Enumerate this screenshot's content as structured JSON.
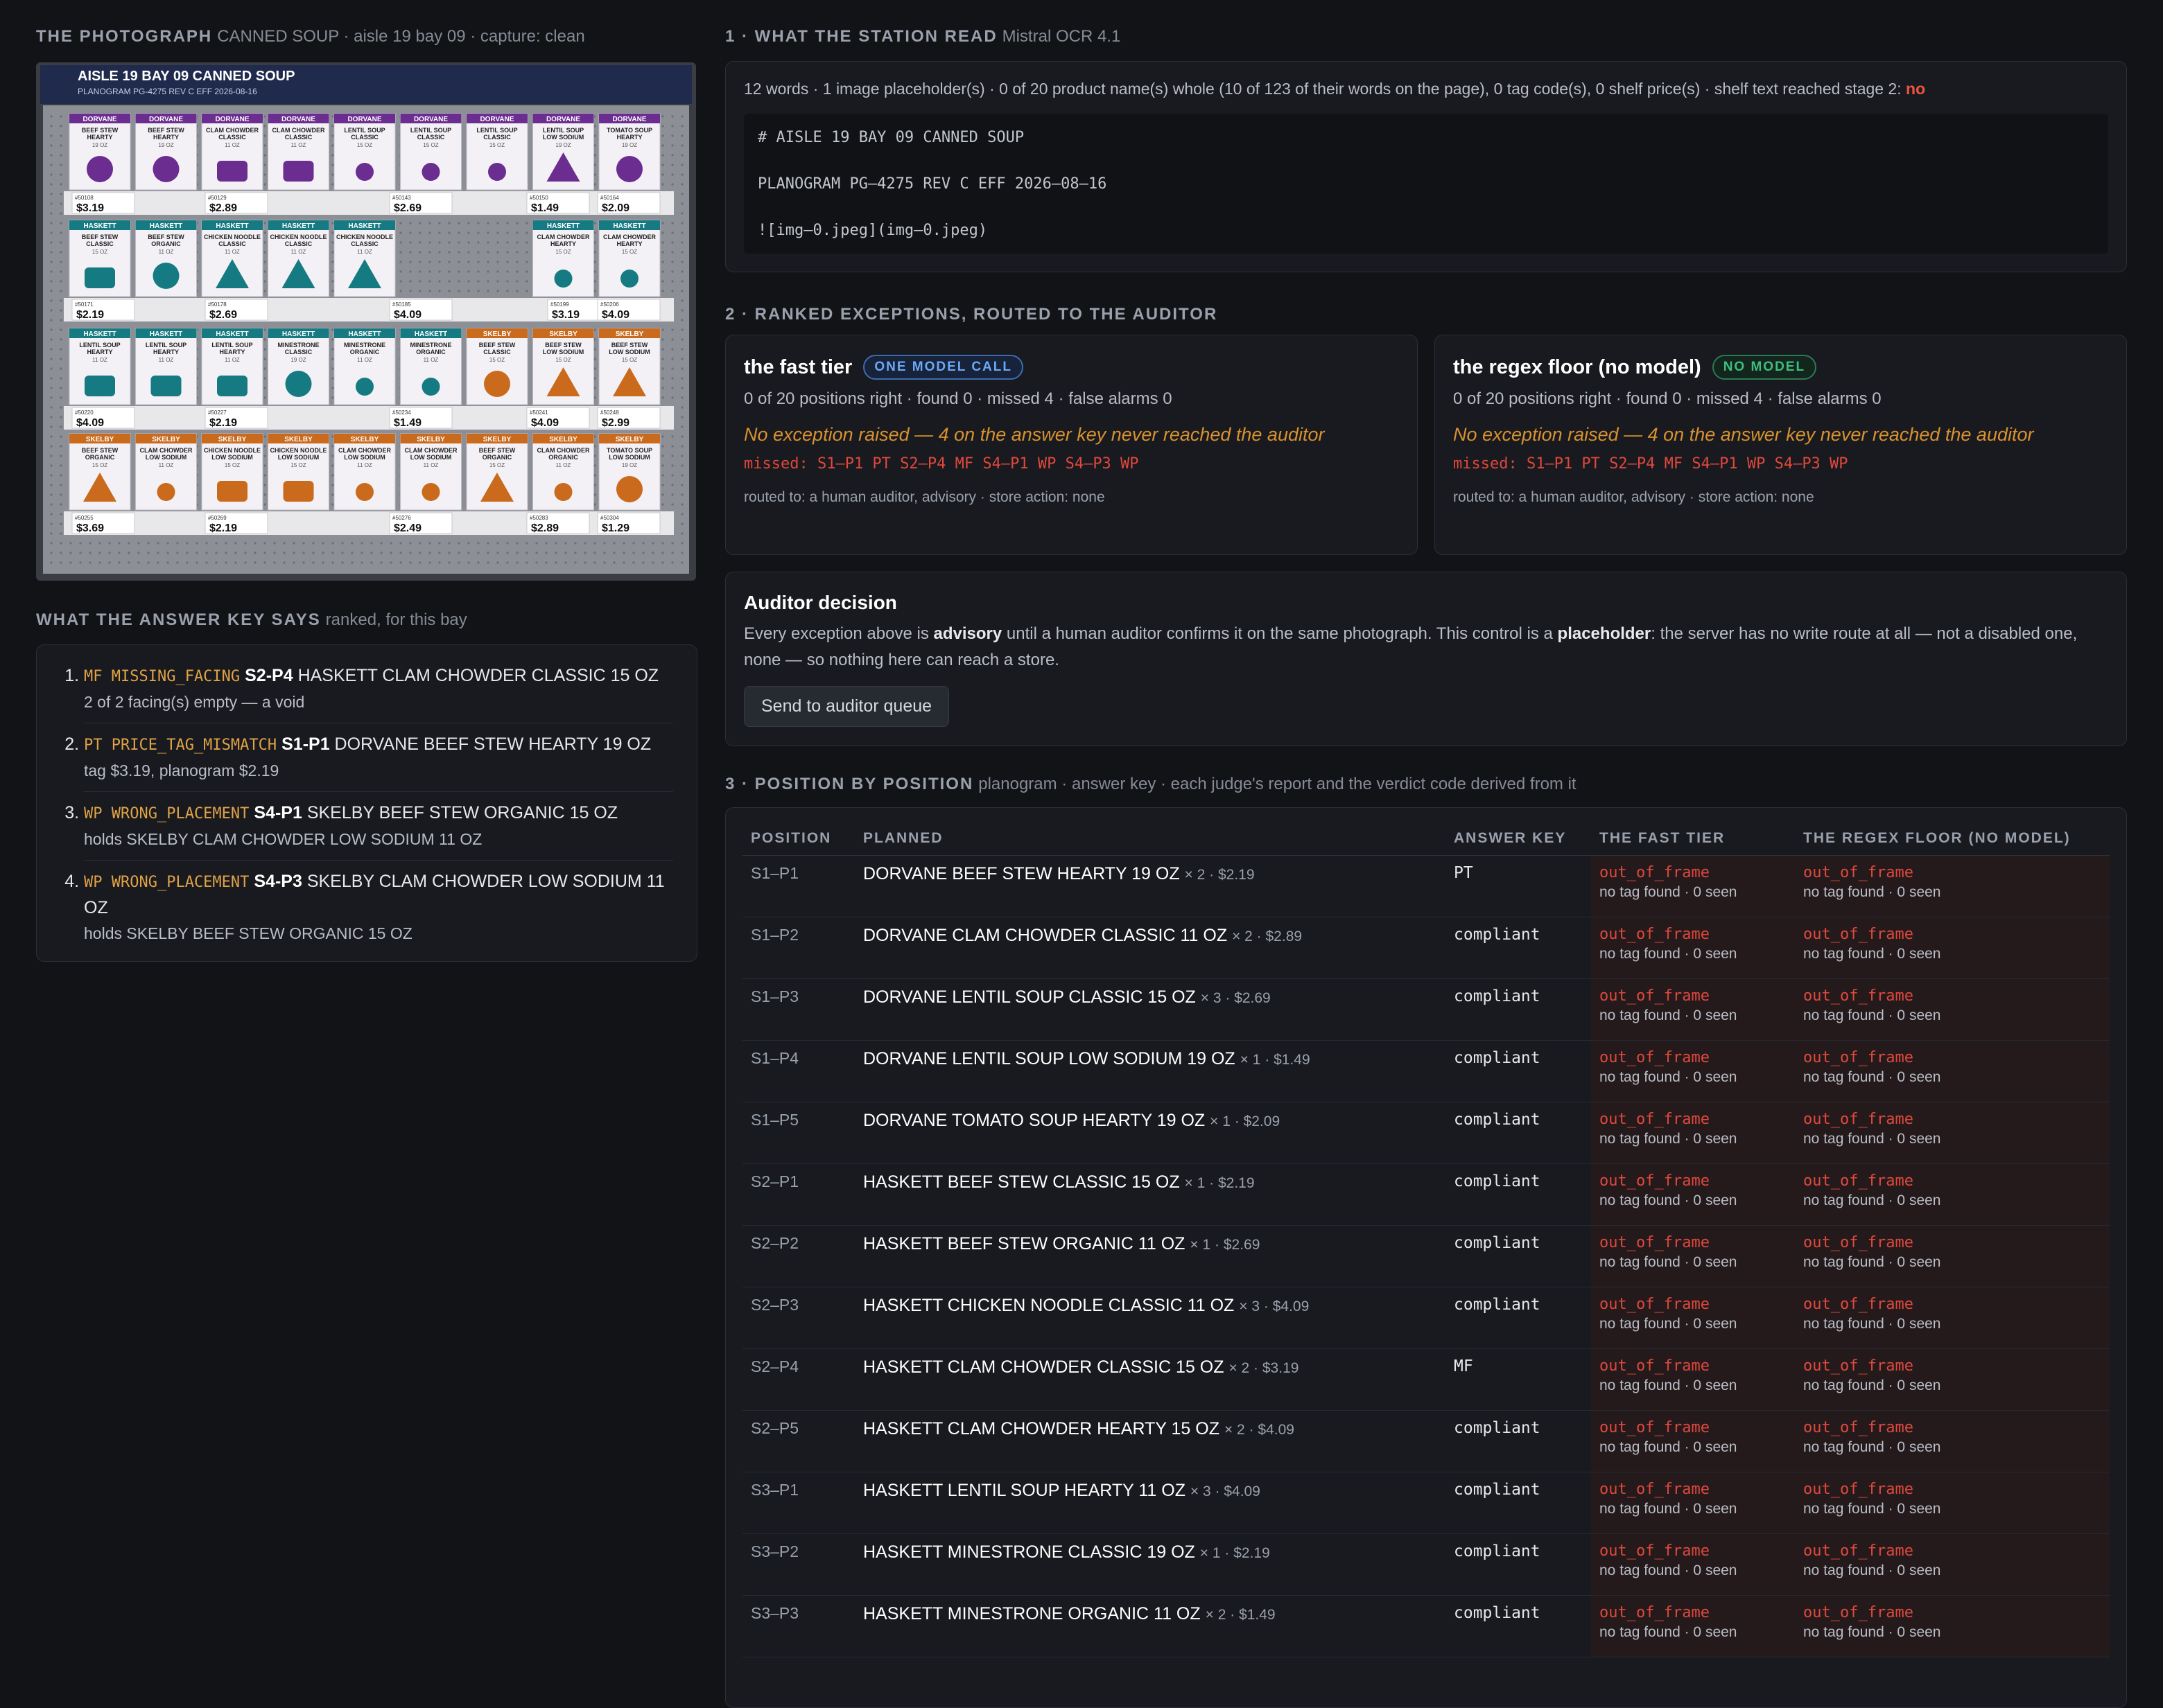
{
  "photo_section": {
    "title": "THE PHOTOGRAPH",
    "subtitle": "CANNED SOUP · aisle 19 bay 09 · capture: clean",
    "header_line": "AISLE 19    BAY 09    CANNED SOUP",
    "header_sub": "PLANOGRAM PG-4275   REV C   EFF 2026-08-16",
    "shelves": [
      [
        {
          "brand": "DORVANE",
          "name": "BEEF STEW HEARTY",
          "size": "19 OZ",
          "shape": "circle"
        },
        {
          "brand": "DORVANE",
          "name": "BEEF STEW HEARTY",
          "size": "19 OZ",
          "shape": "circle"
        },
        {
          "brand": "DORVANE",
          "name": "CLAM CHOWDER CLASSIC",
          "size": "11 OZ",
          "shape": "rect"
        },
        {
          "brand": "DORVANE",
          "name": "CLAM CHOWDER CLASSIC",
          "size": "11 OZ",
          "shape": "rect"
        },
        {
          "brand": "DORVANE",
          "name": "LENTIL SOUP CLASSIC",
          "size": "15 OZ",
          "shape": "small"
        },
        {
          "brand": "DORVANE",
          "name": "LENTIL SOUP CLASSIC",
          "size": "15 OZ",
          "shape": "small"
        },
        {
          "brand": "DORVANE",
          "name": "LENTIL SOUP CLASSIC",
          "size": "15 OZ",
          "shape": "small"
        },
        {
          "brand": "DORVANE",
          "name": "LENTIL SOUP LOW SODIUM",
          "size": "19 OZ",
          "shape": "tri"
        },
        {
          "brand": "DORVANE",
          "name": "TOMATO SOUP HEARTY",
          "size": "19 OZ",
          "shape": "circle"
        }
      ],
      [
        {
          "brand": "HASKETT",
          "name": "BEEF STEW CLASSIC",
          "size": "15 OZ",
          "shape": "rect"
        },
        {
          "brand": "HASKETT",
          "name": "BEEF STEW ORGANIC",
          "size": "11 OZ",
          "shape": "circle"
        },
        {
          "brand": "HASKETT",
          "name": "CHICKEN NOODLE CLASSIC",
          "size": "11 OZ",
          "shape": "tri"
        },
        {
          "brand": "HASKETT",
          "name": "CHICKEN NOODLE CLASSIC",
          "size": "11 OZ",
          "shape": "tri"
        },
        {
          "brand": "HASKETT",
          "name": "CHICKEN NOODLE CLASSIC",
          "size": "11 OZ",
          "shape": "tri"
        },
        null,
        null,
        {
          "brand": "HASKETT",
          "name": "CLAM CHOWDER HEARTY",
          "size": "15 OZ",
          "shape": "small"
        },
        {
          "brand": "HASKETT",
          "name": "CLAM CHOWDER HEARTY",
          "size": "15 OZ",
          "shape": "small"
        }
      ],
      [
        {
          "brand": "HASKETT",
          "name": "LENTIL SOUP HEARTY",
          "size": "11 OZ",
          "shape": "rect"
        },
        {
          "brand": "HASKETT",
          "name": "LENTIL SOUP HEARTY",
          "size": "11 OZ",
          "shape": "rect"
        },
        {
          "brand": "HASKETT",
          "name": "LENTIL SOUP HEARTY",
          "size": "11 OZ",
          "shape": "rect"
        },
        {
          "brand": "HASKETT",
          "name": "MINESTRONE CLASSIC",
          "size": "19 OZ",
          "shape": "circle"
        },
        {
          "brand": "HASKETT",
          "name": "MINESTRONE ORGANIC",
          "size": "11 OZ",
          "shape": "small"
        },
        {
          "brand": "HASKETT",
          "name": "MINESTRONE ORGANIC",
          "size": "11 OZ",
          "shape": "small"
        },
        {
          "brand": "SKELBY",
          "name": "BEEF STEW CLASSIC",
          "size": "15 OZ",
          "shape": "circle"
        },
        {
          "brand": "SKELBY",
          "name": "BEEF STEW LOW SODIUM",
          "size": "15 OZ",
          "shape": "tri"
        },
        {
          "brand": "SKELBY",
          "name": "BEEF STEW LOW SODIUM",
          "size": "15 OZ",
          "shape": "tri"
        }
      ],
      [
        {
          "brand": "SKELBY",
          "name": "BEEF STEW ORGANIC",
          "size": "15 OZ",
          "shape": "tri"
        },
        {
          "brand": "SKELBY",
          "name": "CLAM CHOWDER LOW SODIUM",
          "size": "11 OZ",
          "shape": "small"
        },
        {
          "brand": "SKELBY",
          "name": "CHICKEN NOODLE LOW SODIUM",
          "size": "15 OZ",
          "shape": "rect"
        },
        {
          "brand": "SKELBY",
          "name": "CHICKEN NOODLE LOW SODIUM",
          "size": "15 OZ",
          "shape": "rect"
        },
        {
          "brand": "SKELBY",
          "name": "CLAM CHOWDER LOW SODIUM",
          "size": "11 OZ",
          "shape": "small"
        },
        {
          "brand": "SKELBY",
          "name": "CLAM CHOWDER LOW SODIUM",
          "size": "11 OZ",
          "shape": "small"
        },
        {
          "brand": "SKELBY",
          "name": "BEEF STEW ORGANIC",
          "size": "15 OZ",
          "shape": "tri"
        },
        {
          "brand": "SKELBY",
          "name": "CLAM CHOWDER ORGANIC",
          "size": "11 OZ",
          "shape": "small"
        },
        {
          "brand": "SKELBY",
          "name": "TOMATO SOUP LOW SODIUM",
          "size": "19 OZ",
          "shape": "circle"
        }
      ]
    ],
    "tags": [
      [
        {
          "code": "#50108",
          "price": "$3.19"
        },
        {
          "code": "#50129",
          "price": "$2.89"
        },
        {
          "code": "#50143",
          "price": "$2.69"
        },
        {
          "code": "#50150",
          "price": "$1.49"
        },
        {
          "code": "#50164",
          "price": "$2.09"
        }
      ],
      [
        {
          "code": "#50171",
          "price": "$2.19"
        },
        {
          "code": "#50178",
          "price": "$2.69"
        },
        {
          "code": "#50185",
          "price": "$4.09"
        },
        {
          "code": "#50199",
          "price": "$3.19"
        },
        {
          "code": "#50206",
          "price": "$4.09"
        }
      ],
      [
        {
          "code": "#50220",
          "price": "$4.09"
        },
        {
          "code": "#50227",
          "price": "$2.19"
        },
        {
          "code": "#50234",
          "price": "$1.49"
        },
        {
          "code": "#50241",
          "price": "$4.09"
        },
        {
          "code": "#50248",
          "price": "$2.99"
        }
      ],
      [
        {
          "code": "#50255",
          "price": "$3.69"
        },
        {
          "code": "#50269",
          "price": "$2.19"
        },
        {
          "code": "#50276",
          "price": "$2.49"
        },
        {
          "code": "#50283",
          "price": "$2.89"
        },
        {
          "code": "#50304",
          "price": "$1.29"
        }
      ]
    ],
    "brand_colors": {
      "DORVANE": "#6b2d8f",
      "HASKETT": "#157a82",
      "SKELBY": "#c96a1c"
    }
  },
  "answer_key": {
    "title": "WHAT THE ANSWER KEY SAYS",
    "subtitle": "ranked, for this bay",
    "items": [
      {
        "code": "MF MISSING_FACING",
        "pos": "S2-P4",
        "product": "HASKETT CLAM CHOWDER CLASSIC 15 OZ",
        "detail": "2 of 2 facing(s) empty — a void"
      },
      {
        "code": "PT PRICE_TAG_MISMATCH",
        "pos": "S1-P1",
        "product": "DORVANE BEEF STEW HEARTY 19 OZ",
        "detail": "tag $3.19, planogram $2.19"
      },
      {
        "code": "WP WRONG_PLACEMENT",
        "pos": "S4-P1",
        "product": "SKELBY BEEF STEW ORGANIC 15 OZ",
        "detail": "holds SKELBY CLAM CHOWDER LOW SODIUM 11 OZ"
      },
      {
        "code": "WP WRONG_PLACEMENT",
        "pos": "S4-P3",
        "product": "SKELBY CLAM CHOWDER LOW SODIUM 11 OZ",
        "detail": "holds SKELBY BEEF STEW ORGANIC 15 OZ"
      }
    ]
  },
  "station": {
    "title": "1 · WHAT THE STATION READ",
    "subtitle": "Mistral OCR 4.1",
    "summary": "12 words · 1 image placeholder(s) · 0 of 20 product name(s) whole (10 of 123 of their words on the page), 0 tag code(s), 0 shelf price(s) · shelf text reached stage 2:",
    "summary_flag": "no",
    "ocr_lines": [
      "# AISLE 19 BAY 09 CANNED SOUP",
      "PLANOGRAM PG–4275 REV C EFF 2026–08–16",
      "![img–0.jpeg](img–0.jpeg)"
    ]
  },
  "exceptions": {
    "title": "2 · RANKED EXCEPTIONS, ROUTED TO THE AUDITOR",
    "tiers": [
      {
        "name": "the fast tier",
        "badge": "ONE MODEL CALL",
        "stats": "0 of 20 positions right · found 0 · missed 4 · false alarms 0",
        "warning": "No exception raised — 4 on the answer key never reached the auditor",
        "missed": "missed: S1–P1 PT S2–P4 MF S4–P1 WP S4–P3 WP",
        "route": "routed to: a human auditor, advisory · store action: none"
      },
      {
        "name": "the regex floor (no model)",
        "badge": "NO MODEL",
        "stats": "0 of 20 positions right · found 0 · missed 4 · false alarms 0",
        "warning": "No exception raised — 4 on the answer key never reached the auditor",
        "missed": "missed: S1–P1 PT S2–P4 MF S4–P1 WP S4–P3 WP",
        "route": "routed to: a human auditor, advisory · store action: none"
      }
    ]
  },
  "auditor": {
    "title": "Auditor decision",
    "t1": "Every exception above is ",
    "b1": "advisory",
    "t2": " until a human auditor confirms it on the same photograph. This control is a ",
    "b2": "placeholder",
    "t3": ": the server has no write route at all — not a disabled one, none — so nothing here can reach a store.",
    "button": "Send to auditor queue"
  },
  "positions": {
    "title": "3 · POSITION BY POSITION",
    "subtitle": "planogram · answer key · each judge's report and the verdict code derived from it",
    "headers": [
      "POSITION",
      "PLANNED",
      "ANSWER KEY",
      "THE FAST TIER",
      "THE REGEX FLOOR (NO MODEL)"
    ],
    "verdict": "out_of_frame",
    "note": "no tag found · 0 seen",
    "rows": [
      {
        "pos": "S1–P1",
        "name": "DORVANE BEEF STEW HEARTY 19 OZ",
        "meta": "× 2 · $2.19",
        "key": "PT"
      },
      {
        "pos": "S1–P2",
        "name": "DORVANE CLAM CHOWDER CLASSIC 11 OZ",
        "meta": "× 2 · $2.89",
        "key": "compliant"
      },
      {
        "pos": "S1–P3",
        "name": "DORVANE LENTIL SOUP CLASSIC 15 OZ",
        "meta": "× 3 · $2.69",
        "key": "compliant"
      },
      {
        "pos": "S1–P4",
        "name": "DORVANE LENTIL SOUP LOW SODIUM 19 OZ",
        "meta": "× 1 · $1.49",
        "key": "compliant"
      },
      {
        "pos": "S1–P5",
        "name": "DORVANE TOMATO SOUP HEARTY 19 OZ",
        "meta": "× 1 · $2.09",
        "key": "compliant"
      },
      {
        "pos": "S2–P1",
        "name": "HASKETT BEEF STEW CLASSIC 15 OZ",
        "meta": "× 1 · $2.19",
        "key": "compliant"
      },
      {
        "pos": "S2–P2",
        "name": "HASKETT BEEF STEW ORGANIC 11 OZ",
        "meta": "× 1 · $2.69",
        "key": "compliant"
      },
      {
        "pos": "S2–P3",
        "name": "HASKETT CHICKEN NOODLE CLASSIC 11 OZ",
        "meta": "× 3 · $4.09",
        "key": "compliant"
      },
      {
        "pos": "S2–P4",
        "name": "HASKETT CLAM CHOWDER CLASSIC 15 OZ",
        "meta": "× 2 · $3.19",
        "key": "MF"
      },
      {
        "pos": "S2–P5",
        "name": "HASKETT CLAM CHOWDER HEARTY 15 OZ",
        "meta": "× 2 · $4.09",
        "key": "compliant"
      },
      {
        "pos": "S3–P1",
        "name": "HASKETT LENTIL SOUP HEARTY 11 OZ",
        "meta": "× 3 · $4.09",
        "key": "compliant"
      },
      {
        "pos": "S3–P2",
        "name": "HASKETT MINESTRONE CLASSIC 19 OZ",
        "meta": "× 1 · $2.19",
        "key": "compliant"
      },
      {
        "pos": "S3–P3",
        "name": "HASKETT MINESTRONE ORGANIC 11 OZ",
        "meta": "× 2 · $1.49",
        "key": "compliant"
      }
    ]
  }
}
